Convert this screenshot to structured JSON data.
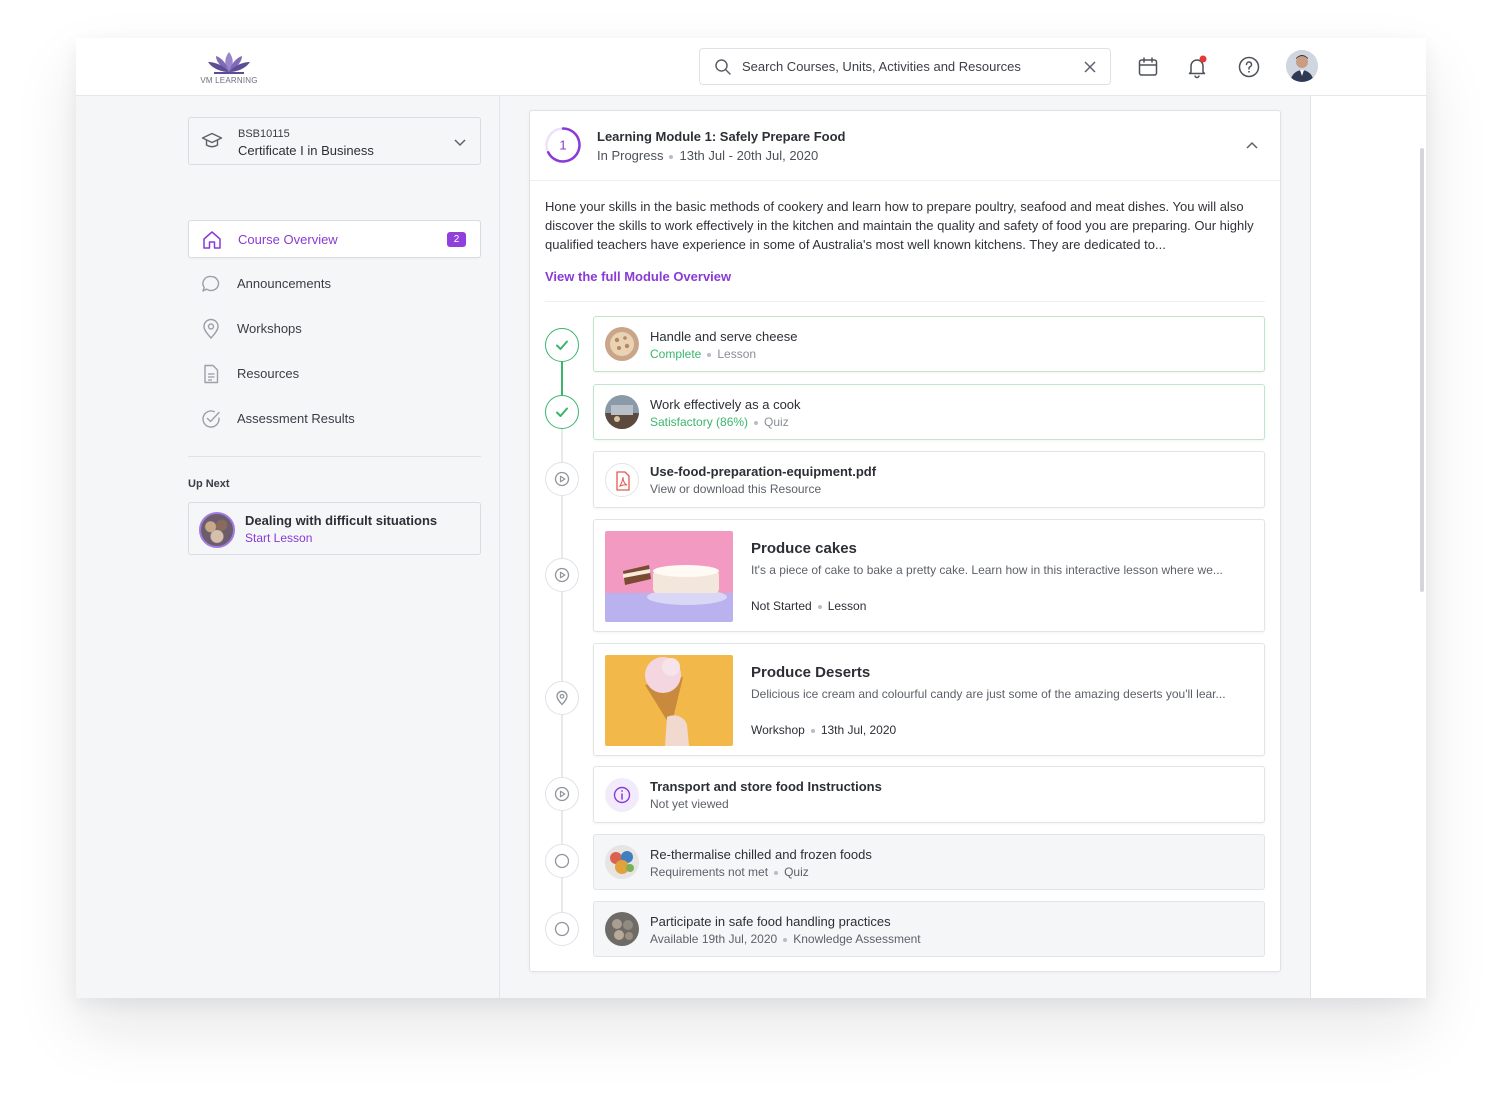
{
  "header": {
    "logo_text": "VM LEARNING",
    "search_placeholder": "Search Courses, Units, Activities and Resources"
  },
  "sidebar": {
    "course": {
      "code": "BSB10115",
      "name": "Certificate I in Business"
    },
    "nav": [
      {
        "label": "Course Overview",
        "badge": "2",
        "icon": "home-icon",
        "active": true
      },
      {
        "label": "Announcements",
        "icon": "chat-bubble-icon"
      },
      {
        "label": "Workshops",
        "icon": "map-pin-icon"
      },
      {
        "label": "Resources",
        "icon": "document-icon"
      },
      {
        "label": "Assessment Results",
        "icon": "check-circle-icon"
      }
    ],
    "up_next": {
      "heading": "Up Next",
      "title": "Dealing with difficult situations",
      "action": "Start Lesson"
    }
  },
  "module": {
    "number": "1",
    "title": "Learning Module 1: Safely Prepare Food",
    "status": "In Progress",
    "dates": "13th Jul - 20th Jul, 2020",
    "description": "Hone your skills in the basic methods of cookery and learn how to prepare poultry, seafood and meat dishes. You will also discover the skills to work effectively in the kitchen and maintain the quality and safety of food you are preparing. Our highly qualified teachers have experience in some of Australia's most well known kitchens. They are dedicated to...",
    "link": "View the full Module Overview",
    "items": [
      {
        "title": "Handle and serve cheese",
        "status": "Complete",
        "type": "Lesson"
      },
      {
        "title": "Work effectively as a cook",
        "status": "Satisfactory (86%)",
        "type": "Quiz"
      },
      {
        "title": "Use-food-preparation-equipment.pdf",
        "status": "View or download this Resource"
      },
      {
        "title": "Produce cakes",
        "description": "It's a piece of cake to bake a pretty cake. Learn how in this interactive lesson where we...",
        "status": "Not Started",
        "type": "Lesson"
      },
      {
        "title": "Produce Deserts",
        "description": "Delicious ice cream and colourful candy are just some of the amazing deserts you'll lear...",
        "status": "Workshop",
        "type": "13th Jul, 2020"
      },
      {
        "title": "Transport and store food Instructions",
        "status": "Not yet viewed"
      },
      {
        "title": "Re-thermalise chilled and frozen foods",
        "status": "Requirements not met",
        "type": "Quiz"
      },
      {
        "title": "Participate in safe food handling practices",
        "status": "Available 19th Jul, 2020",
        "type": "Knowledge Assessment"
      }
    ]
  },
  "colors": {
    "accent": "#8a3ad6",
    "success": "#3bb56d",
    "notification": "#e53935"
  }
}
